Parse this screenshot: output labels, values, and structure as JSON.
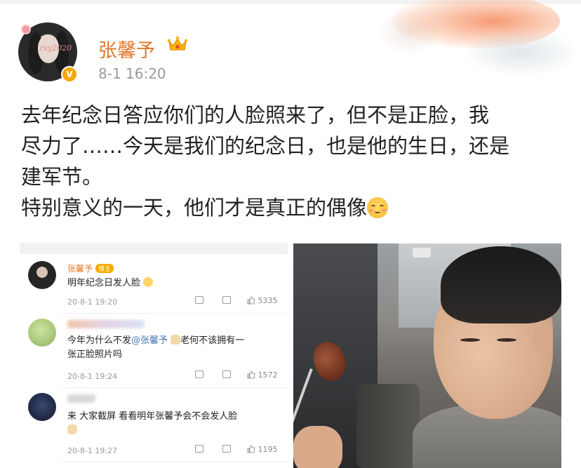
{
  "post": {
    "username": "张馨予",
    "timestamp": "8-1 16:20",
    "avatar_frame_text": "zxy2020",
    "verified_badge": "V",
    "lines": [
      "去年纪念日答应你们的人脸照来了，但不是正脸，我",
      "尽力了……今天是我们的纪念日，也是他的生日，还是",
      "建军节。",
      "特别意义的一天，他们才是真正的偶像"
    ],
    "emoji": "blush-smile-emoji"
  },
  "comments": [
    {
      "name": "张馨予",
      "level": "博主",
      "body": "明年纪念日发人脸",
      "time": "20-8-1 19:20",
      "likes": "5335"
    },
    {
      "name": "",
      "level": "",
      "body_prefix": "今年为什么不发",
      "mention": "@张馨予",
      "body_suffix": "老何不该拥有一",
      "body_line2": "张正脸照片吗",
      "time": "20-8-1 19:24",
      "likes": "1572"
    },
    {
      "name": "",
      "level": "",
      "body": "来 大家截屏 看看明年张馨予会不会发人脸",
      "time": "20-8-1 19:27",
      "likes": "1195"
    }
  ],
  "colors": {
    "username": "#e2772a",
    "badge": "#f7a800",
    "mention": "#4a78b6",
    "meta": "#9a9a9a"
  }
}
